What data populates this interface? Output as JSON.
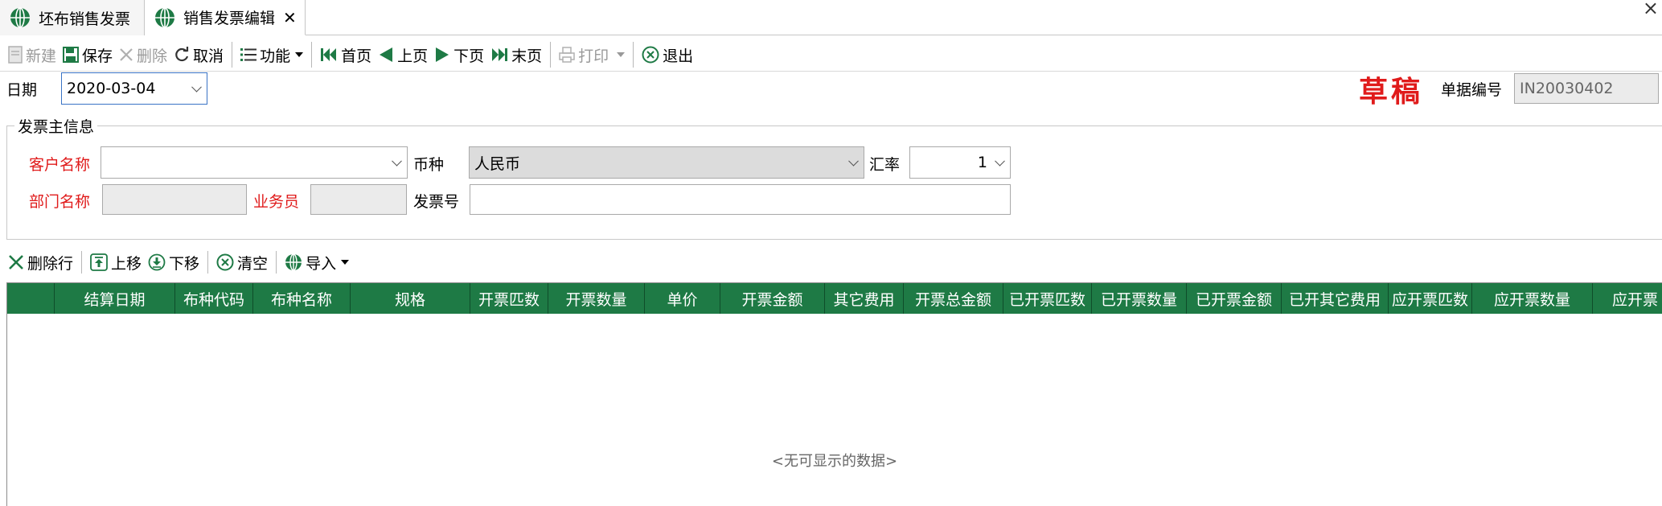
{
  "tabs": [
    {
      "label": "坯布销售发票",
      "active": false
    },
    {
      "label": "销售发票编辑",
      "active": true,
      "closable": true
    }
  ],
  "window": {
    "close_glyph": "×"
  },
  "toolbar": {
    "new": "新建",
    "save": "保存",
    "delete": "删除",
    "cancel": "取消",
    "function": "功能",
    "first": "首页",
    "prev": "上页",
    "next": "下页",
    "last": "末页",
    "print": "打印",
    "exit": "退出"
  },
  "header": {
    "date_label": "日期",
    "date_value": "2020-03-04",
    "status": "草稿",
    "doc_no_label": "单据编号",
    "doc_no_value": "IN20030402"
  },
  "invoice_info": {
    "title": "发票主信息",
    "customer_label": "客户名称",
    "customer_value": "",
    "currency_label": "币种",
    "currency_value": "人民币",
    "rate_label": "汇率",
    "rate_value": "1",
    "dept_label": "部门名称",
    "dept_value": "",
    "salesman_label": "业务员",
    "salesman_value": "",
    "invoice_no_label": "发票号",
    "invoice_no_value": ""
  },
  "detail_toolbar": {
    "delete_row": "删除行",
    "move_up": "上移",
    "move_down": "下移",
    "clear": "清空",
    "import": "导入"
  },
  "grid": {
    "columns": [
      "",
      "结算日期",
      "布种代码",
      "布种名称",
      "规格",
      "开票匹数",
      "开票数量",
      "单价",
      "开票金额",
      "其它费用",
      "开票总金额",
      "已开票匹数",
      "已开票数量",
      "已开票金额",
      "已开其它费用",
      "应开票匹数",
      "应开票数量",
      "应开票"
    ],
    "rows": [],
    "empty_text": "<无可显示的数据>"
  },
  "colors": {
    "grid_header_bg": "#1e7a45",
    "required_label": "#e01b1b",
    "draft_stamp": "#e01b1b"
  }
}
